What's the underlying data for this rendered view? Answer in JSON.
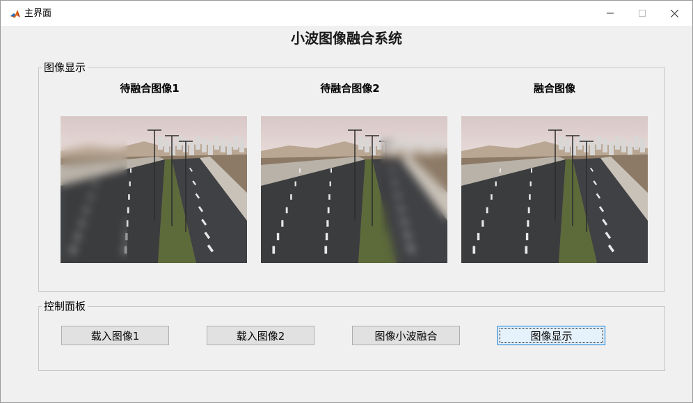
{
  "window": {
    "title": "主界面",
    "icon": "matlab-icon"
  },
  "app": {
    "title": "小波图像融合系统"
  },
  "display_panel": {
    "legend": "图像显示",
    "images": [
      {
        "label": "待融合图像1",
        "blur_side": "left"
      },
      {
        "label": "待融合图像2",
        "blur_side": "right"
      },
      {
        "label": "融合图像",
        "blur_side": "none"
      }
    ]
  },
  "control_panel": {
    "legend": "控制面板",
    "buttons": [
      {
        "label": "载入图像1"
      },
      {
        "label": "载入图像2"
      },
      {
        "label": "图像小波融合"
      },
      {
        "label": "图像显示",
        "focused": true
      }
    ]
  }
}
